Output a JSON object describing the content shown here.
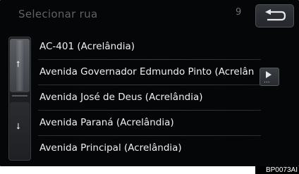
{
  "header": {
    "title": "Selecionar rua",
    "counter": "9"
  },
  "streets": [
    "AC-401 (Acrelândia)",
    "Avenida Governador Edmundo Pinto (Acrelân",
    "Avenida José de Deus (Acrelândia)",
    "Avenida Paraná (Acrelândia)",
    "Avenida Principal (Acrelândia)"
  ],
  "scroll": {
    "up_icon": "arrow-up-icon",
    "down_icon": "arrow-down-icon"
  },
  "more": {
    "icon": "play-triangle-icon",
    "dots": "..."
  },
  "back": {
    "icon": "return-arrow-icon"
  },
  "image_code": "BP0073AI"
}
